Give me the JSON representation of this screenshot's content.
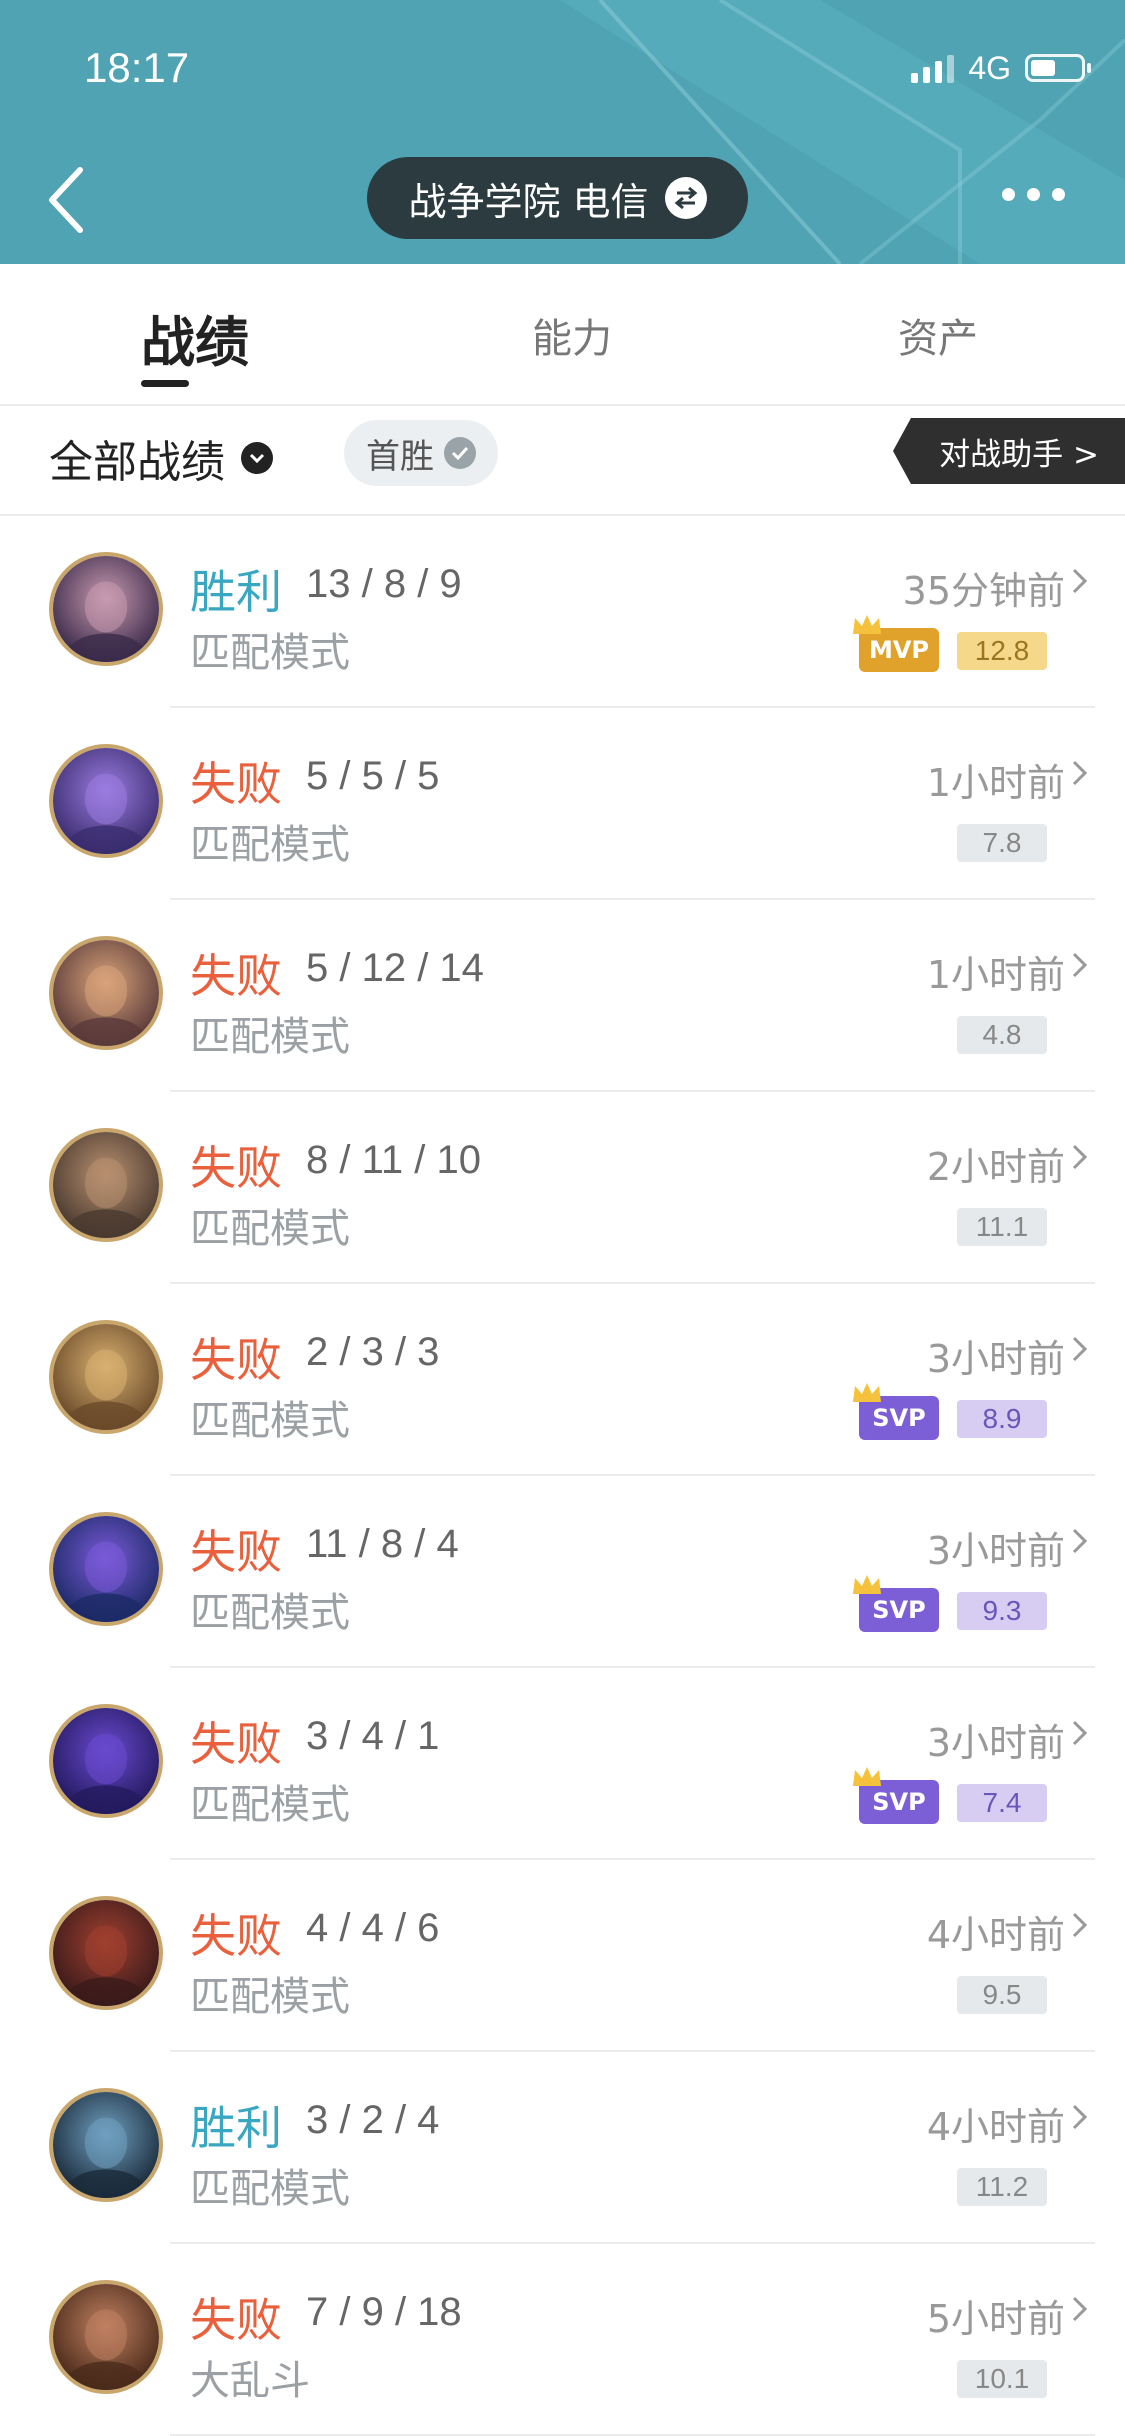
{
  "status": {
    "time": "18:17",
    "network": "4G"
  },
  "header": {
    "server_name": "战争学院 电信"
  },
  "tabs": [
    {
      "label": "战绩"
    },
    {
      "label": "能力"
    },
    {
      "label": "资产"
    }
  ],
  "filter": {
    "all_label": "全部战绩",
    "first_win_label": "首胜",
    "assistant_label": "对战助手 >"
  },
  "colors": {
    "header_bg": "#4fa3b3",
    "win": "#3aa7c2",
    "lose": "#e8603c",
    "mvp": "#e0a22a",
    "svp": "#7c5fd6"
  },
  "matches": [
    {
      "result": "胜利",
      "kda": "13 / 8 / 9",
      "mode": "匹配模式",
      "time": "35分钟前",
      "score": "12.8",
      "badge": "MVP"
    },
    {
      "result": "失败",
      "kda": "5 / 5 / 5",
      "mode": "匹配模式",
      "time": "1小时前",
      "score": "7.8",
      "badge": ""
    },
    {
      "result": "失败",
      "kda": "5 / 12 / 14",
      "mode": "匹配模式",
      "time": "1小时前",
      "score": "4.8",
      "badge": ""
    },
    {
      "result": "失败",
      "kda": "8 / 11 / 10",
      "mode": "匹配模式",
      "time": "2小时前",
      "score": "11.1",
      "badge": ""
    },
    {
      "result": "失败",
      "kda": "2 / 3 / 3",
      "mode": "匹配模式",
      "time": "3小时前",
      "score": "8.9",
      "badge": "SVP"
    },
    {
      "result": "失败",
      "kda": "11 / 8 / 4",
      "mode": "匹配模式",
      "time": "3小时前",
      "score": "9.3",
      "badge": "SVP"
    },
    {
      "result": "失败",
      "kda": "3 / 4 / 1",
      "mode": "匹配模式",
      "time": "3小时前",
      "score": "7.4",
      "badge": "SVP"
    },
    {
      "result": "失败",
      "kda": "4 / 4 / 6",
      "mode": "匹配模式",
      "time": "4小时前",
      "score": "9.5",
      "badge": ""
    },
    {
      "result": "胜利",
      "kda": "3 / 2 / 4",
      "mode": "匹配模式",
      "time": "4小时前",
      "score": "11.2",
      "badge": ""
    },
    {
      "result": "失败",
      "kda": "7 / 9 / 18",
      "mode": "大乱斗",
      "time": "5小时前",
      "score": "10.1",
      "badge": ""
    }
  ]
}
